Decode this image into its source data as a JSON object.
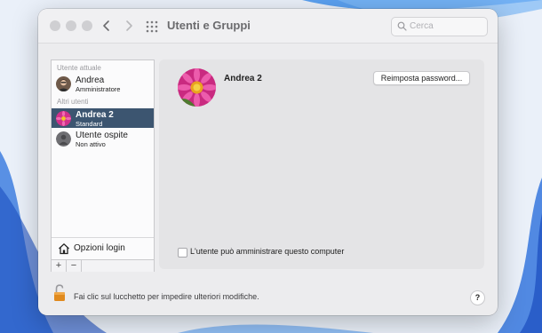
{
  "window": {
    "title": "Utenti e Gruppi",
    "search_placeholder": "Cerca"
  },
  "sidebar": {
    "current_user_label": "Utente attuale",
    "other_users_label": "Altri utenti",
    "users": [
      {
        "name": "Andrea",
        "role": "Amministratore",
        "avatar": "person-photo"
      },
      {
        "name": "Andrea 2",
        "role": "Standard",
        "avatar": "pink-flower-photo",
        "selected": true
      },
      {
        "name": "Utente ospite",
        "role": "Non attivo",
        "avatar": "guest-silhouette"
      }
    ],
    "login_options_label": "Opzioni login",
    "add_label": "+",
    "remove_label": "−"
  },
  "panel": {
    "user_name": "Andrea 2",
    "reset_password_label": "Reimposta password...",
    "admin_checkbox_label": "L'utente può amministrare questo computer",
    "admin_checked": false
  },
  "footer": {
    "lock_text": "Fai clic sul lucchetto per impedire ulteriori modifiche.",
    "help_label": "?"
  },
  "colors": {
    "selection": "#3c5570",
    "window_bg": "#ececee",
    "panel_bg": "#e4e4e6"
  }
}
